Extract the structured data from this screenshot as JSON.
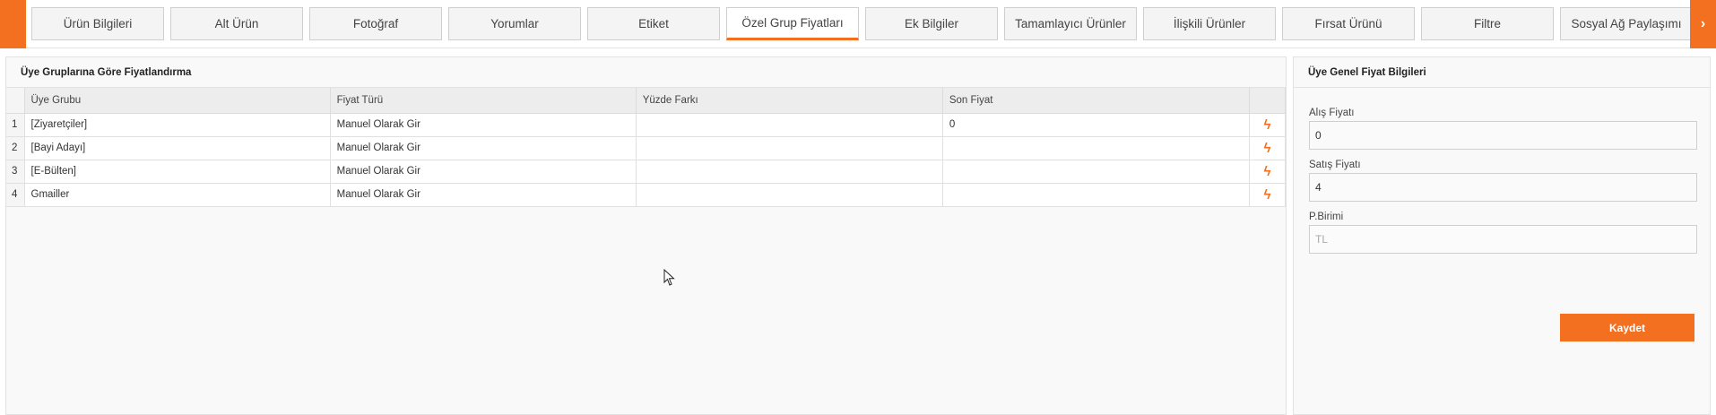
{
  "tabs": [
    {
      "label": "Ürün Bilgileri"
    },
    {
      "label": "Alt Ürün"
    },
    {
      "label": "Fotoğraf"
    },
    {
      "label": "Yorumlar"
    },
    {
      "label": "Etiket"
    },
    {
      "label": "Özel Grup Fiyatları",
      "active": true
    },
    {
      "label": "Ek Bilgiler"
    },
    {
      "label": "Tamamlayıcı Ürünler"
    },
    {
      "label": "İlişkili Ürünler"
    },
    {
      "label": "Fırsat Ürünü"
    },
    {
      "label": "Filtre"
    },
    {
      "label": "Sosyal Ağ Paylaşımı"
    }
  ],
  "nav": {
    "right_arrow": "›",
    "left_arrow": ""
  },
  "pricing_panel": {
    "title": "Üye Gruplarına Göre Fiyatlandırma",
    "columns": {
      "group": "Üye Grubu",
      "price_type": "Fiyat Türü",
      "percent_diff": "Yüzde Farkı",
      "final_price": "Son Fiyat"
    },
    "rows": [
      {
        "num": "1",
        "group": "[Ziyaretçiler]",
        "price_type": "Manuel Olarak Gir",
        "percent_diff": "",
        "final_price": "0"
      },
      {
        "num": "2",
        "group": "[Bayi Adayı]",
        "price_type": "Manuel Olarak Gir",
        "percent_diff": "",
        "final_price": ""
      },
      {
        "num": "3",
        "group": "[E-Bülten]",
        "price_type": "Manuel Olarak Gir",
        "percent_diff": "",
        "final_price": ""
      },
      {
        "num": "4",
        "group": "Gmailler",
        "price_type": "Manuel Olarak Gir",
        "percent_diff": "",
        "final_price": ""
      }
    ],
    "action_icon": "lightning-icon"
  },
  "general_panel": {
    "title": "Üye Genel Fiyat Bilgileri",
    "purchase_label": "Alış Fiyatı",
    "purchase_value": "0",
    "sale_label": "Satış Fiyatı",
    "sale_value": "4",
    "unit_label": "P.Birimi",
    "unit_value": "TL",
    "save_label": "Kaydet"
  },
  "colors": {
    "accent": "#f37021"
  }
}
